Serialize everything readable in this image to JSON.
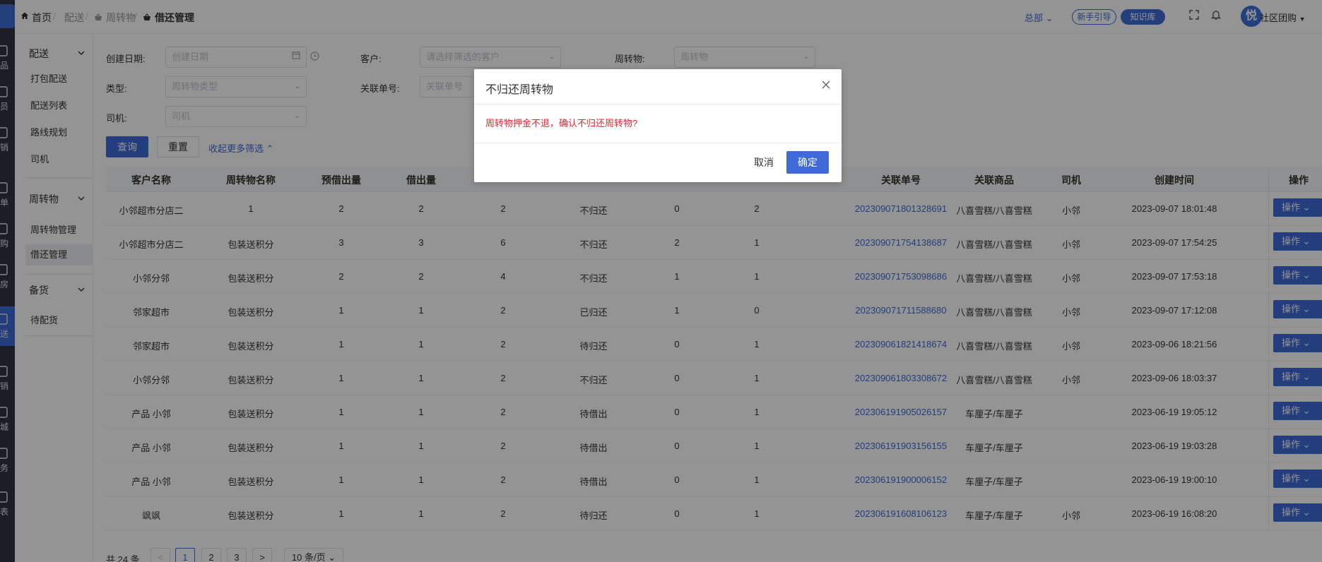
{
  "topbar": {
    "breadcrumb": {
      "home": "首页",
      "level1": "配送",
      "level2": "周转物",
      "current": "借还管理"
    },
    "org": "总部",
    "guide_label": "新手引导",
    "kb_label": "知识库",
    "user_name": "社区团购",
    "avatar_text": "悦"
  },
  "rail": {
    "items": [
      {
        "label": "品"
      },
      {
        "label": "员"
      },
      {
        "label": "销"
      },
      {
        "label": "单"
      },
      {
        "label": "购"
      },
      {
        "label": "房"
      },
      {
        "label": "送"
      },
      {
        "label": "销"
      },
      {
        "label": "城"
      },
      {
        "label": "务"
      },
      {
        "label": "表"
      }
    ]
  },
  "submenu": {
    "groups": [
      {
        "label": "配送",
        "items": [
          "打包配送",
          "配送列表",
          "路线规划",
          "司机"
        ]
      },
      {
        "label": "周转物",
        "items": [
          "周转物管理",
          "借还管理"
        ]
      },
      {
        "label": "备货",
        "items": [
          "待配货"
        ]
      }
    ]
  },
  "filters": {
    "created_label": "创建日期:",
    "created_placeholder": "创建日期",
    "customer_label": "客户:",
    "customer_placeholder": "请选择筛选的客户",
    "item_label": "周转物:",
    "item_placeholder": "周转物",
    "type_label": "类型:",
    "type_placeholder": "周转物类型",
    "related_label": "关联单号:",
    "related_placeholder": "关联单号",
    "driver_label": "司机:",
    "driver_placeholder": "司机",
    "query": "查询",
    "reset": "重置",
    "collapse": "收起更多筛选"
  },
  "table": {
    "columns": [
      "客户名称",
      "周转物名称",
      "预借出量",
      "借出量",
      "",
      "",
      "",
      "",
      "关联单号",
      "关联商品",
      "司机",
      "创建时间",
      "操作"
    ],
    "op_label": "操作",
    "rows": [
      {
        "customer": "小邻超市分店二",
        "item": "1",
        "pre": "2",
        "lent": "2",
        "c5": "2",
        "status": "不归还",
        "c7": "0",
        "c8": "2",
        "order": "202309071801328691",
        "goods": "八喜雪糕/八喜雪糕",
        "driver": "小邻",
        "time": "2023-09-07 18:01:48"
      },
      {
        "customer": "小邻超市分店二",
        "item": "包装送积分",
        "pre": "3",
        "lent": "3",
        "c5": "6",
        "status": "不归还",
        "c7": "2",
        "c8": "1",
        "order": "202309071754138687",
        "goods": "八喜雪糕/八喜雪糕",
        "driver": "小邻",
        "time": "2023-09-07 17:54:25"
      },
      {
        "customer": "小邻分邻",
        "item": "包装送积分",
        "pre": "2",
        "lent": "2",
        "c5": "4",
        "status": "不归还",
        "c7": "1",
        "c8": "1",
        "order": "202309071753098686",
        "goods": "八喜雪糕/八喜雪糕",
        "driver": "小邻",
        "time": "2023-09-07 17:53:18"
      },
      {
        "customer": "邻家超市",
        "item": "包装送积分",
        "pre": "1",
        "lent": "1",
        "c5": "2",
        "status": "已归还",
        "c7": "1",
        "c8": "0",
        "order": "202309071711588680",
        "goods": "八喜雪糕/八喜雪糕",
        "driver": "小邻",
        "time": "2023-09-07 17:12:08"
      },
      {
        "customer": "邻家超市",
        "item": "包装送积分",
        "pre": "1",
        "lent": "1",
        "c5": "2",
        "status": "待归还",
        "c7": "0",
        "c8": "1",
        "order": "202309061821418674",
        "goods": "八喜雪糕/八喜雪糕",
        "driver": "小邻",
        "time": "2023-09-06 18:21:56"
      },
      {
        "customer": "小邻分邻",
        "item": "包装送积分",
        "pre": "1",
        "lent": "1",
        "c5": "2",
        "status": "不归还",
        "c7": "0",
        "c8": "1",
        "order": "202309061803308672",
        "goods": "八喜雪糕/八喜雪糕",
        "driver": "小邻",
        "time": "2023-09-06 18:03:37"
      },
      {
        "customer": "产品 小邻",
        "item": "包装送积分",
        "pre": "1",
        "lent": "1",
        "c5": "2",
        "status": "待借出",
        "c7": "0",
        "c8": "1",
        "order": "202306191905026157",
        "goods": "车厘子/车厘子",
        "driver": "",
        "time": "2023-06-19 19:05:12"
      },
      {
        "customer": "产品 小邻",
        "item": "包装送积分",
        "pre": "1",
        "lent": "1",
        "c5": "2",
        "status": "待借出",
        "c7": "0",
        "c8": "1",
        "order": "202306191903156155",
        "goods": "车厘子/车厘子",
        "driver": "",
        "time": "2023-06-19 19:03:28"
      },
      {
        "customer": "产品 小邻",
        "item": "包装送积分",
        "pre": "1",
        "lent": "1",
        "c5": "2",
        "status": "待借出",
        "c7": "0",
        "c8": "1",
        "order": "202306191900006152",
        "goods": "车厘子/车厘子",
        "driver": "",
        "time": "2023-06-19 19:00:10"
      },
      {
        "customer": "飒飒",
        "item": "包装送积分",
        "pre": "1",
        "lent": "1",
        "c5": "2",
        "status": "待归还",
        "c7": "0",
        "c8": "1",
        "order": "202306191608106123",
        "goods": "车厘子/车厘子",
        "driver": "小邻",
        "time": "2023-06-19 16:08:20"
      }
    ]
  },
  "pager": {
    "total": "共 24 条",
    "prev": "<",
    "next": ">",
    "pages": [
      "1",
      "2",
      "3"
    ],
    "size": "10 条/页"
  },
  "dialog": {
    "title": "不归还周转物",
    "message": "周转物押金不退，确认不归还周转物?",
    "cancel": "取消",
    "ok": "确定"
  }
}
